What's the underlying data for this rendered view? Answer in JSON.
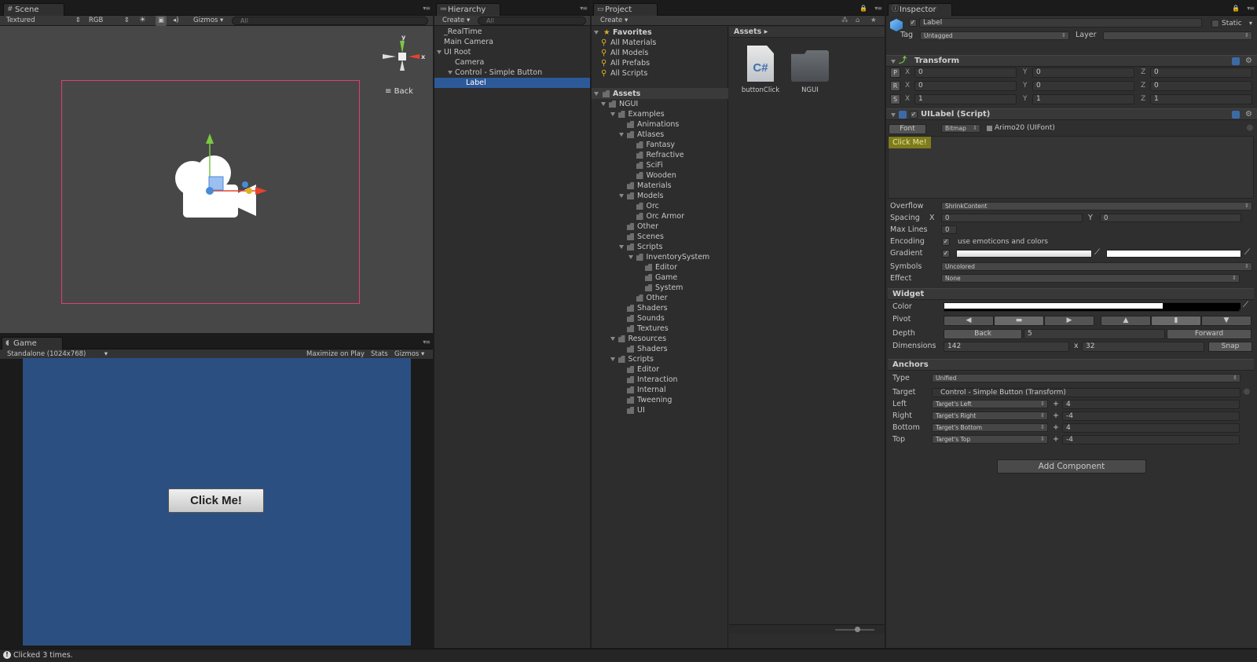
{
  "colors": {
    "game_bg": "#2b4f80",
    "frame": "#e23c74",
    "selection": "#2c5a99",
    "label_highlight": "#7f7c1c"
  },
  "scene": {
    "tab": "Scene",
    "tab_icon": "grid-icon",
    "toolbar": {
      "shading": "Textured",
      "mode": "RGB",
      "gizmos": "Gizmos",
      "search": "All"
    },
    "gizmo_axes": {
      "y": "y",
      "x": "x"
    },
    "view_label": "Back"
  },
  "game": {
    "tab": "Game",
    "tab_icon": "pacman-icon",
    "toolbar": {
      "resolution": "Standalone (1024x768)",
      "maximize": "Maximize on Play",
      "stats": "Stats",
      "gizmos": "Gizmos"
    },
    "button_label": "Click Me!"
  },
  "hierarchy": {
    "tab": "Hierarchy",
    "create": "Create",
    "search": "All",
    "items": [
      {
        "label": "_RealTime",
        "depth": 0,
        "expanded": null,
        "selected": false
      },
      {
        "label": "Main Camera",
        "depth": 0,
        "expanded": null,
        "selected": false
      },
      {
        "label": "UI Root",
        "depth": 0,
        "expanded": true,
        "selected": false
      },
      {
        "label": "Camera",
        "depth": 1,
        "expanded": null,
        "selected": false
      },
      {
        "label": "Control - Simple Button",
        "depth": 1,
        "expanded": true,
        "selected": false
      },
      {
        "label": "Label",
        "depth": 2,
        "expanded": null,
        "selected": true
      }
    ]
  },
  "project": {
    "tab": "Project",
    "create": "Create",
    "favorites_label": "Favorites",
    "favorites": [
      "All Materials",
      "All Models",
      "All Prefabs",
      "All Scripts"
    ],
    "assets_label": "Assets",
    "breadcrumb": "Assets",
    "tree": [
      {
        "label": "NGUI",
        "depth": 0,
        "expanded": true
      },
      {
        "label": "Examples",
        "depth": 1,
        "expanded": true
      },
      {
        "label": "Animations",
        "depth": 2,
        "expanded": null
      },
      {
        "label": "Atlases",
        "depth": 2,
        "expanded": true
      },
      {
        "label": "Fantasy",
        "depth": 3,
        "expanded": null
      },
      {
        "label": "Refractive",
        "depth": 3,
        "expanded": null
      },
      {
        "label": "SciFi",
        "depth": 3,
        "expanded": null
      },
      {
        "label": "Wooden",
        "depth": 3,
        "expanded": null
      },
      {
        "label": "Materials",
        "depth": 2,
        "expanded": null
      },
      {
        "label": "Models",
        "depth": 2,
        "expanded": true
      },
      {
        "label": "Orc",
        "depth": 3,
        "expanded": null
      },
      {
        "label": "Orc Armor",
        "depth": 3,
        "expanded": null
      },
      {
        "label": "Other",
        "depth": 2,
        "expanded": null
      },
      {
        "label": "Scenes",
        "depth": 2,
        "expanded": null
      },
      {
        "label": "Scripts",
        "depth": 2,
        "expanded": true
      },
      {
        "label": "InventorySystem",
        "depth": 3,
        "expanded": true
      },
      {
        "label": "Editor",
        "depth": 4,
        "expanded": null
      },
      {
        "label": "Game",
        "depth": 4,
        "expanded": null
      },
      {
        "label": "System",
        "depth": 4,
        "expanded": null
      },
      {
        "label": "Other",
        "depth": 3,
        "expanded": null
      },
      {
        "label": "Shaders",
        "depth": 2,
        "expanded": null
      },
      {
        "label": "Sounds",
        "depth": 2,
        "expanded": null
      },
      {
        "label": "Textures",
        "depth": 2,
        "expanded": null
      },
      {
        "label": "Resources",
        "depth": 1,
        "expanded": true
      },
      {
        "label": "Shaders",
        "depth": 2,
        "expanded": null
      },
      {
        "label": "Scripts",
        "depth": 1,
        "expanded": true
      },
      {
        "label": "Editor",
        "depth": 2,
        "expanded": null
      },
      {
        "label": "Interaction",
        "depth": 2,
        "expanded": null
      },
      {
        "label": "Internal",
        "depth": 2,
        "expanded": null
      },
      {
        "label": "Tweening",
        "depth": 2,
        "expanded": null
      },
      {
        "label": "UI",
        "depth": 2,
        "expanded": null
      }
    ],
    "grid_items": [
      {
        "label": "buttonClick",
        "icon": "csharp-script-icon",
        "glyph": "C#"
      },
      {
        "label": "NGUI",
        "icon": "folder-icon"
      }
    ]
  },
  "inspector": {
    "tab": "Inspector",
    "object_name": "Label",
    "static_label": "Static",
    "tag_label": "Tag",
    "tag": "Untagged",
    "layer_label": "Layer",
    "layer": "",
    "transform": {
      "title": "Transform",
      "rows": [
        {
          "btn": "P",
          "x": "0",
          "y": "0",
          "z": "0"
        },
        {
          "btn": "R",
          "x": "0",
          "y": "0",
          "z": "0"
        },
        {
          "btn": "S",
          "x": "1",
          "y": "1",
          "z": "1"
        }
      ]
    },
    "uilabel": {
      "title": "UILabel (Script)",
      "font_btn": "Font",
      "font_type": "Bitmap",
      "font_value": "Arimo20 (UIFont)",
      "text": "Click Me!",
      "overflow_label": "Overflow",
      "overflow": "ShrinkContent",
      "spacing_label": "Spacing",
      "spacing_x_label": "X",
      "spacing_x": "0",
      "spacing_y_label": "Y",
      "spacing_y": "0",
      "maxlines_label": "Max Lines",
      "maxlines": "0",
      "encoding_label": "Encoding",
      "encoding_text": "use emoticons and colors",
      "gradient_label": "Gradient",
      "symbols_label": "Symbols",
      "symbols": "Uncolored",
      "effect_label": "Effect",
      "effect": "None"
    },
    "widget": {
      "title": "Widget",
      "color_label": "Color",
      "pivot_label": "Pivot",
      "depth_label": "Depth",
      "back": "Back",
      "depth": "5",
      "forward": "Forward",
      "dimensions_label": "Dimensions",
      "width": "142",
      "x_sep": "x",
      "height": "32",
      "snap": "Snap"
    },
    "anchors": {
      "title": "Anchors",
      "type_label": "Type",
      "type": "Unified",
      "target_label": "Target",
      "target": "Control - Simple Button (Transform)",
      "rows": [
        {
          "label": "Left",
          "mode": "Target's Left",
          "value": "4"
        },
        {
          "label": "Right",
          "mode": "Target's Right",
          "value": "-4"
        },
        {
          "label": "Bottom",
          "mode": "Target's Bottom",
          "value": "4"
        },
        {
          "label": "Top",
          "mode": "Target's Top",
          "value": "-4"
        }
      ]
    },
    "add_component": "Add Component"
  },
  "status": {
    "text": "Clicked 3 times."
  }
}
